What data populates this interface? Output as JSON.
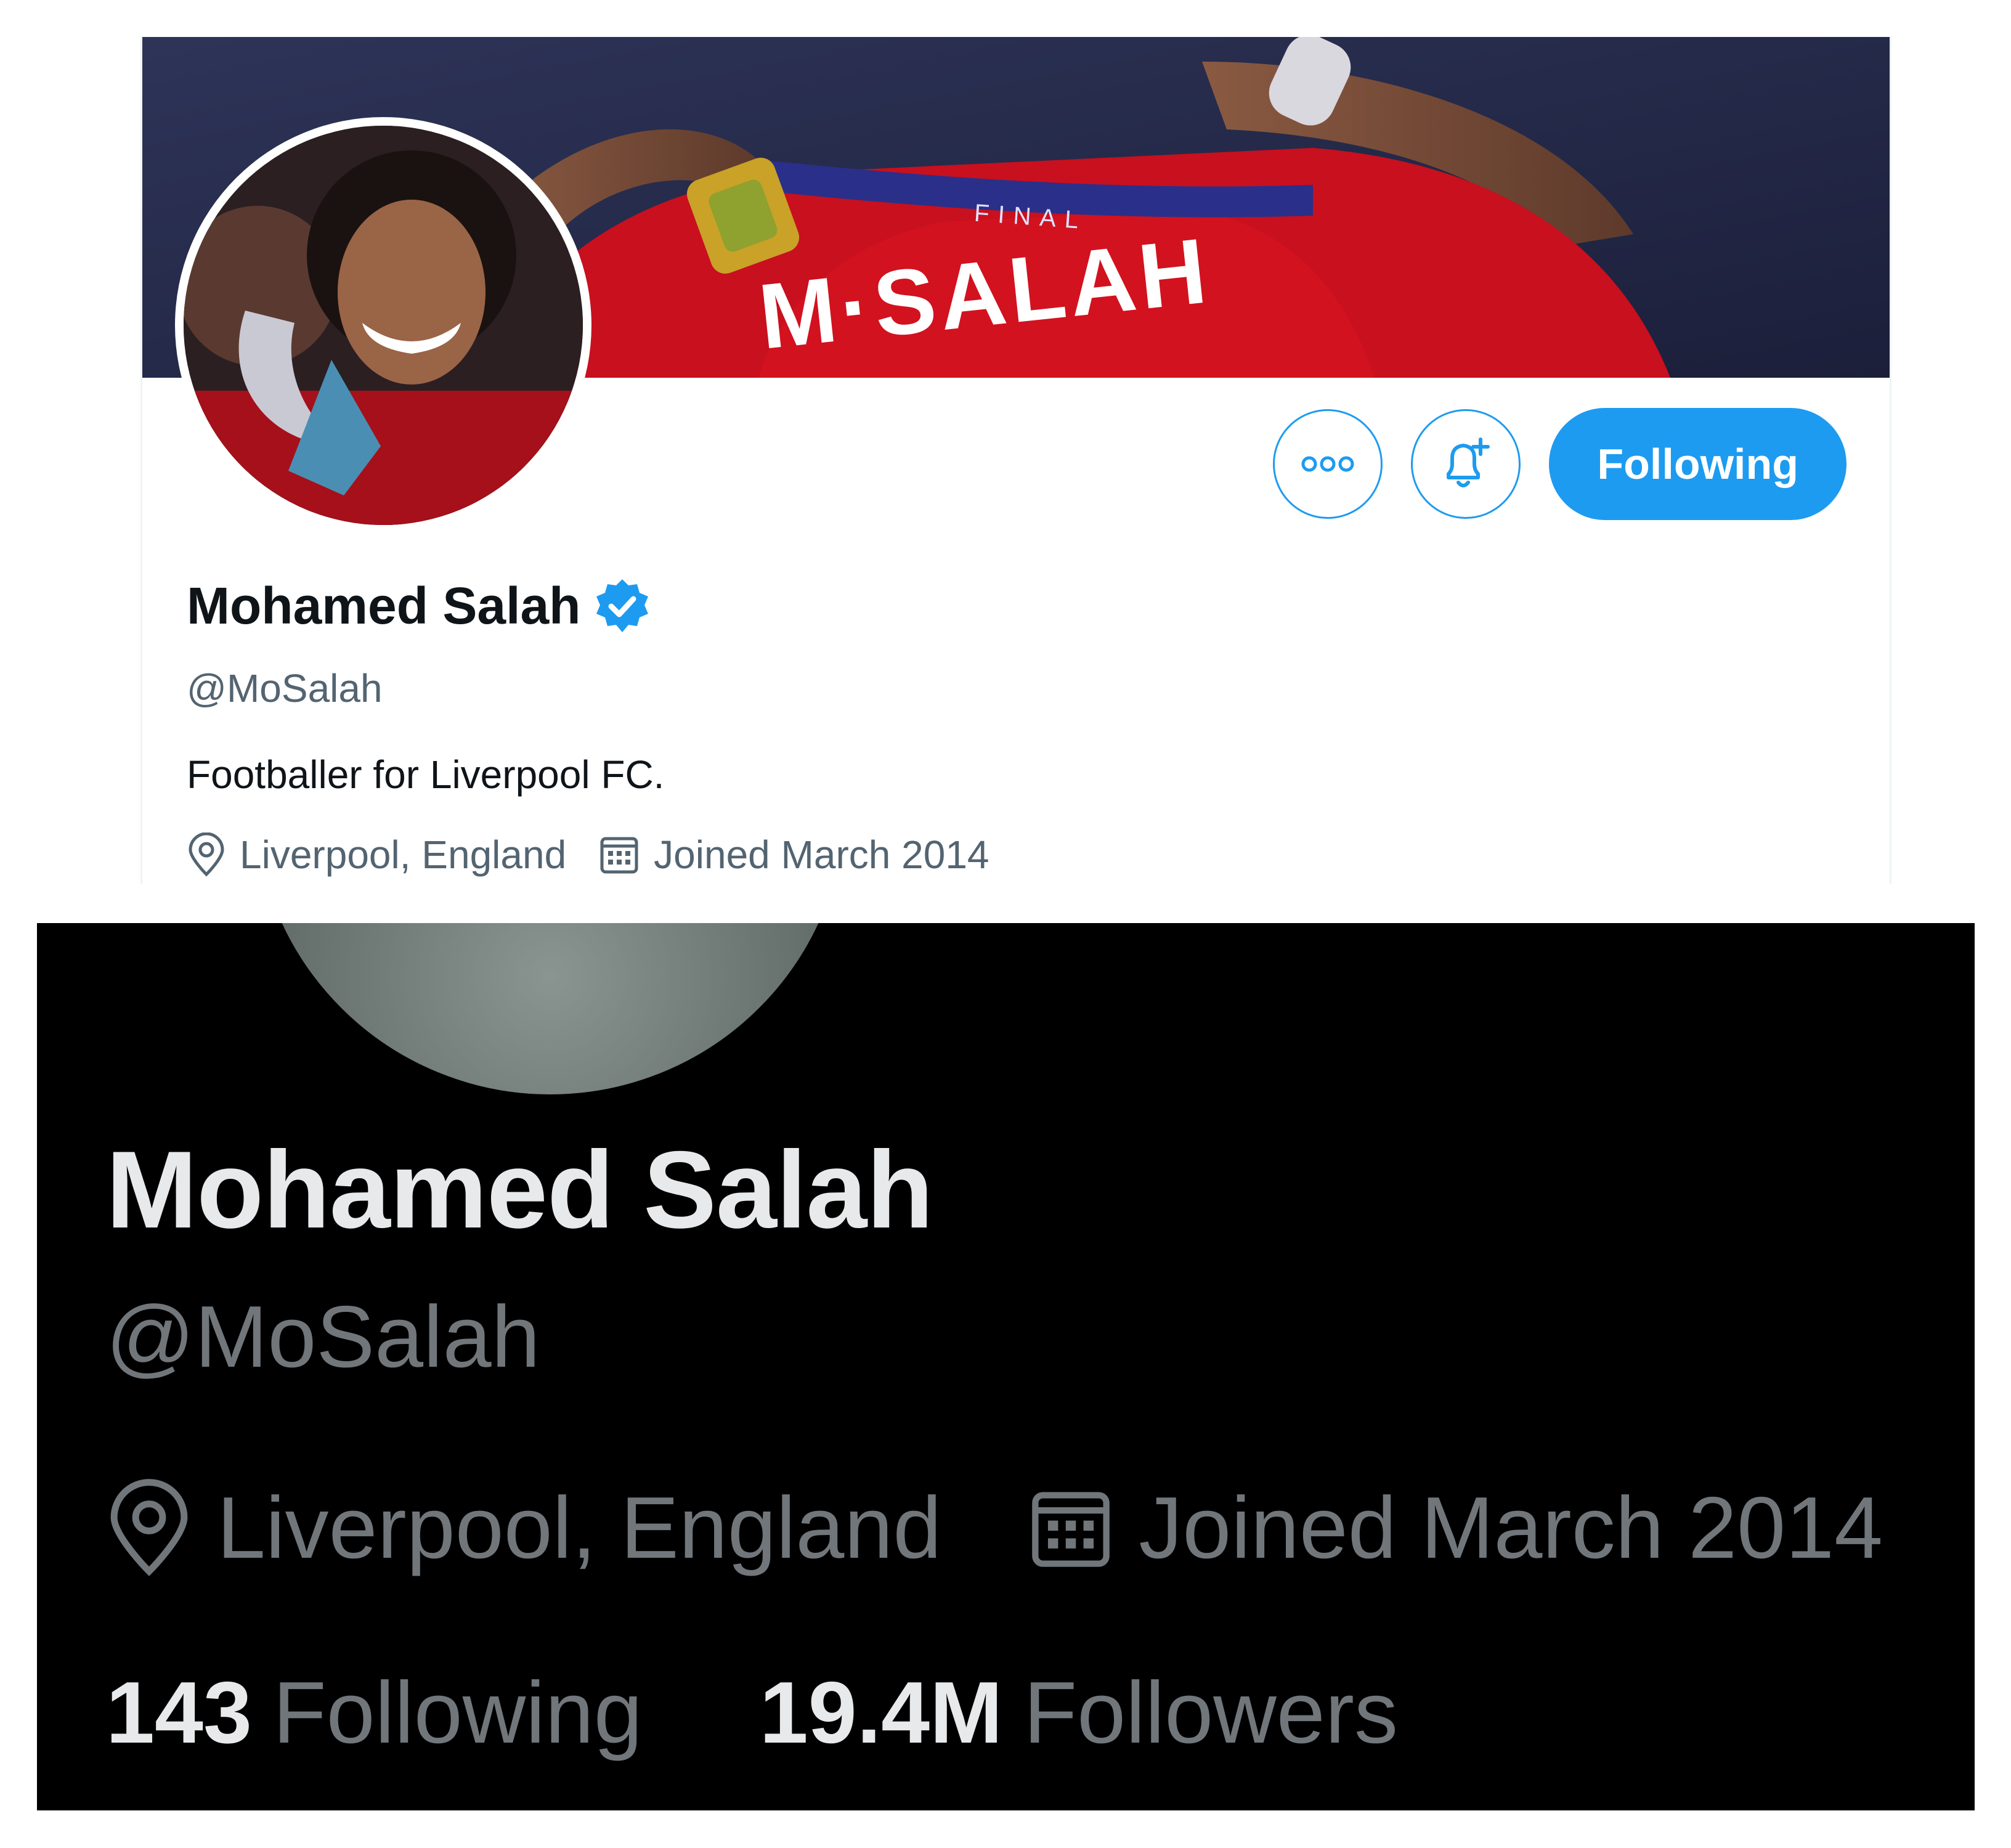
{
  "light_profile": {
    "banner_text": "M·SALAH",
    "banner_ribbon_text": "FINAL",
    "name": "Mohamed Salah",
    "handle": "@MoSalah",
    "bio": "Footballer for Liverpool FC.",
    "location": "Liverpool, England",
    "joined": "Joined March 2014",
    "follow_button_label": "Following",
    "more_icon": "more-dots-icon",
    "notify_icon": "bell-plus-icon",
    "verified_icon": "verified-badge-icon",
    "location_icon": "location-pin-icon",
    "calendar_icon": "calendar-icon"
  },
  "dark_profile": {
    "name": "Mohamed Salah",
    "handle": "@MoSalah",
    "location": "Liverpool, England",
    "joined": "Joined March 2014",
    "following_count": "143",
    "following_label": "Following",
    "followers_count": "19.4M",
    "followers_label": "Followers"
  },
  "colors": {
    "accent": "#1d9bf0",
    "light_text": "#0f1419",
    "light_secondary": "#536471",
    "dark_bg": "#000000",
    "dark_text": "#e7e9ea",
    "dark_secondary": "#71767b"
  }
}
